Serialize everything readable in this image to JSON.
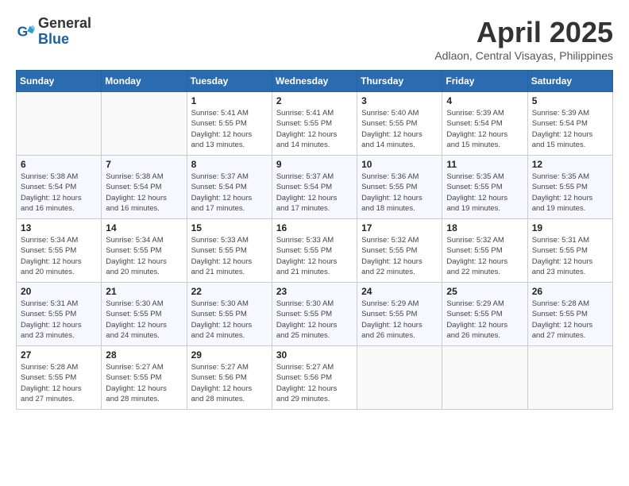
{
  "header": {
    "logo_general": "General",
    "logo_blue": "Blue",
    "month_title": "April 2025",
    "location": "Adlaon, Central Visayas, Philippines"
  },
  "weekdays": [
    "Sunday",
    "Monday",
    "Tuesday",
    "Wednesday",
    "Thursday",
    "Friday",
    "Saturday"
  ],
  "weeks": [
    [
      {
        "day": "",
        "info": ""
      },
      {
        "day": "",
        "info": ""
      },
      {
        "day": "1",
        "info": "Sunrise: 5:41 AM\nSunset: 5:55 PM\nDaylight: 12 hours\nand 13 minutes."
      },
      {
        "day": "2",
        "info": "Sunrise: 5:41 AM\nSunset: 5:55 PM\nDaylight: 12 hours\nand 14 minutes."
      },
      {
        "day": "3",
        "info": "Sunrise: 5:40 AM\nSunset: 5:55 PM\nDaylight: 12 hours\nand 14 minutes."
      },
      {
        "day": "4",
        "info": "Sunrise: 5:39 AM\nSunset: 5:54 PM\nDaylight: 12 hours\nand 15 minutes."
      },
      {
        "day": "5",
        "info": "Sunrise: 5:39 AM\nSunset: 5:54 PM\nDaylight: 12 hours\nand 15 minutes."
      }
    ],
    [
      {
        "day": "6",
        "info": "Sunrise: 5:38 AM\nSunset: 5:54 PM\nDaylight: 12 hours\nand 16 minutes."
      },
      {
        "day": "7",
        "info": "Sunrise: 5:38 AM\nSunset: 5:54 PM\nDaylight: 12 hours\nand 16 minutes."
      },
      {
        "day": "8",
        "info": "Sunrise: 5:37 AM\nSunset: 5:54 PM\nDaylight: 12 hours\nand 17 minutes."
      },
      {
        "day": "9",
        "info": "Sunrise: 5:37 AM\nSunset: 5:54 PM\nDaylight: 12 hours\nand 17 minutes."
      },
      {
        "day": "10",
        "info": "Sunrise: 5:36 AM\nSunset: 5:55 PM\nDaylight: 12 hours\nand 18 minutes."
      },
      {
        "day": "11",
        "info": "Sunrise: 5:35 AM\nSunset: 5:55 PM\nDaylight: 12 hours\nand 19 minutes."
      },
      {
        "day": "12",
        "info": "Sunrise: 5:35 AM\nSunset: 5:55 PM\nDaylight: 12 hours\nand 19 minutes."
      }
    ],
    [
      {
        "day": "13",
        "info": "Sunrise: 5:34 AM\nSunset: 5:55 PM\nDaylight: 12 hours\nand 20 minutes."
      },
      {
        "day": "14",
        "info": "Sunrise: 5:34 AM\nSunset: 5:55 PM\nDaylight: 12 hours\nand 20 minutes."
      },
      {
        "day": "15",
        "info": "Sunrise: 5:33 AM\nSunset: 5:55 PM\nDaylight: 12 hours\nand 21 minutes."
      },
      {
        "day": "16",
        "info": "Sunrise: 5:33 AM\nSunset: 5:55 PM\nDaylight: 12 hours\nand 21 minutes."
      },
      {
        "day": "17",
        "info": "Sunrise: 5:32 AM\nSunset: 5:55 PM\nDaylight: 12 hours\nand 22 minutes."
      },
      {
        "day": "18",
        "info": "Sunrise: 5:32 AM\nSunset: 5:55 PM\nDaylight: 12 hours\nand 22 minutes."
      },
      {
        "day": "19",
        "info": "Sunrise: 5:31 AM\nSunset: 5:55 PM\nDaylight: 12 hours\nand 23 minutes."
      }
    ],
    [
      {
        "day": "20",
        "info": "Sunrise: 5:31 AM\nSunset: 5:55 PM\nDaylight: 12 hours\nand 23 minutes."
      },
      {
        "day": "21",
        "info": "Sunrise: 5:30 AM\nSunset: 5:55 PM\nDaylight: 12 hours\nand 24 minutes."
      },
      {
        "day": "22",
        "info": "Sunrise: 5:30 AM\nSunset: 5:55 PM\nDaylight: 12 hours\nand 24 minutes."
      },
      {
        "day": "23",
        "info": "Sunrise: 5:30 AM\nSunset: 5:55 PM\nDaylight: 12 hours\nand 25 minutes."
      },
      {
        "day": "24",
        "info": "Sunrise: 5:29 AM\nSunset: 5:55 PM\nDaylight: 12 hours\nand 26 minutes."
      },
      {
        "day": "25",
        "info": "Sunrise: 5:29 AM\nSunset: 5:55 PM\nDaylight: 12 hours\nand 26 minutes."
      },
      {
        "day": "26",
        "info": "Sunrise: 5:28 AM\nSunset: 5:55 PM\nDaylight: 12 hours\nand 27 minutes."
      }
    ],
    [
      {
        "day": "27",
        "info": "Sunrise: 5:28 AM\nSunset: 5:55 PM\nDaylight: 12 hours\nand 27 minutes."
      },
      {
        "day": "28",
        "info": "Sunrise: 5:27 AM\nSunset: 5:55 PM\nDaylight: 12 hours\nand 28 minutes."
      },
      {
        "day": "29",
        "info": "Sunrise: 5:27 AM\nSunset: 5:56 PM\nDaylight: 12 hours\nand 28 minutes."
      },
      {
        "day": "30",
        "info": "Sunrise: 5:27 AM\nSunset: 5:56 PM\nDaylight: 12 hours\nand 29 minutes."
      },
      {
        "day": "",
        "info": ""
      },
      {
        "day": "",
        "info": ""
      },
      {
        "day": "",
        "info": ""
      }
    ]
  ]
}
